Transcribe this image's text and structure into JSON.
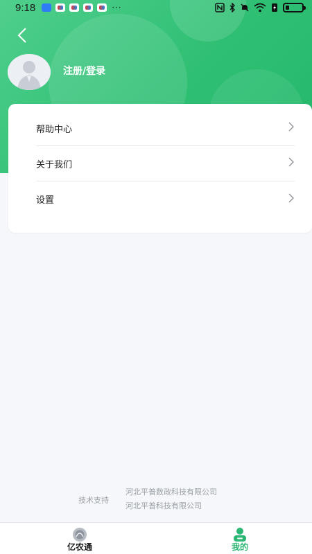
{
  "status_bar": {
    "time": "9:18",
    "more_indicator": "···",
    "icons": [
      "nfc-icon",
      "bluetooth-icon",
      "mute-icon",
      "wifi-icon",
      "battery-saver-icon",
      "battery-icon"
    ]
  },
  "header": {
    "back_icon": "chevron-left-icon",
    "login_label": "注册/登录",
    "avatar_icon": "default-user-avatar",
    "gradient_colors": [
      "#4fcf8c",
      "#23b86a"
    ]
  },
  "menu": {
    "items": [
      {
        "label": "帮助中心",
        "icon": "chevron-right-icon"
      },
      {
        "label": "关于我们",
        "icon": "chevron-right-icon"
      },
      {
        "label": "设置",
        "icon": "chevron-right-icon"
      }
    ]
  },
  "footer": {
    "tech_label": "技术支持",
    "companies": [
      "河北平普数政科技有限公司",
      "河北平普科技有限公司"
    ]
  },
  "tabbar": {
    "tabs": [
      {
        "label": "亿农通",
        "icon": "yinongtong-logo-icon",
        "active": false
      },
      {
        "label": "我的",
        "icon": "user-profile-icon",
        "active": true
      }
    ],
    "active_color": "#2bb673"
  }
}
